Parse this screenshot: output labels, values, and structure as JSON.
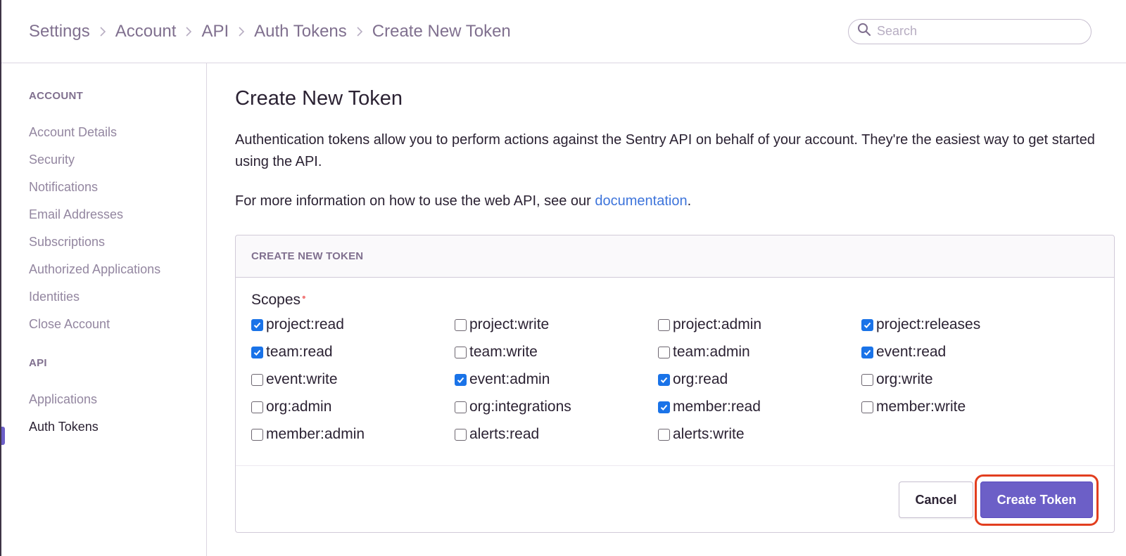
{
  "breadcrumb": [
    "Settings",
    "Account",
    "API",
    "Auth Tokens",
    "Create New Token"
  ],
  "search": {
    "placeholder": "Search"
  },
  "sidebar": {
    "account_heading": "ACCOUNT",
    "account_items": [
      "Account Details",
      "Security",
      "Notifications",
      "Email Addresses",
      "Subscriptions",
      "Authorized Applications",
      "Identities",
      "Close Account"
    ],
    "api_heading": "API",
    "api_items": [
      "Applications",
      "Auth Tokens"
    ],
    "active_item": "Auth Tokens"
  },
  "main": {
    "title": "Create New Token",
    "description": "Authentication tokens allow you to perform actions against the Sentry API on behalf of your account. They're the easiest way to get started using the API.",
    "info_prefix": "For more information on how to use the web API, see our ",
    "info_link": "documentation",
    "info_suffix": "."
  },
  "panel": {
    "header": "CREATE NEW TOKEN",
    "scopes_label": "Scopes",
    "required_marker": "•",
    "scopes": [
      {
        "label": "project:read",
        "checked": true
      },
      {
        "label": "project:write",
        "checked": false
      },
      {
        "label": "project:admin",
        "checked": false
      },
      {
        "label": "project:releases",
        "checked": true
      },
      {
        "label": "team:read",
        "checked": true
      },
      {
        "label": "team:write",
        "checked": false
      },
      {
        "label": "team:admin",
        "checked": false
      },
      {
        "label": "event:read",
        "checked": true
      },
      {
        "label": "event:write",
        "checked": false
      },
      {
        "label": "event:admin",
        "checked": true
      },
      {
        "label": "org:read",
        "checked": true
      },
      {
        "label": "org:write",
        "checked": false
      },
      {
        "label": "org:admin",
        "checked": false
      },
      {
        "label": "org:integrations",
        "checked": false
      },
      {
        "label": "member:read",
        "checked": true
      },
      {
        "label": "member:write",
        "checked": false
      },
      {
        "label": "member:admin",
        "checked": false
      },
      {
        "label": "alerts:read",
        "checked": false
      },
      {
        "label": "alerts:write",
        "checked": false
      }
    ],
    "cancel_label": "Cancel",
    "create_label": "Create Token"
  },
  "colors": {
    "accent": "#6c5fc7",
    "link": "#3d74db",
    "checkbox_checked": "#1a73e8",
    "highlight": "#e23e1f"
  }
}
